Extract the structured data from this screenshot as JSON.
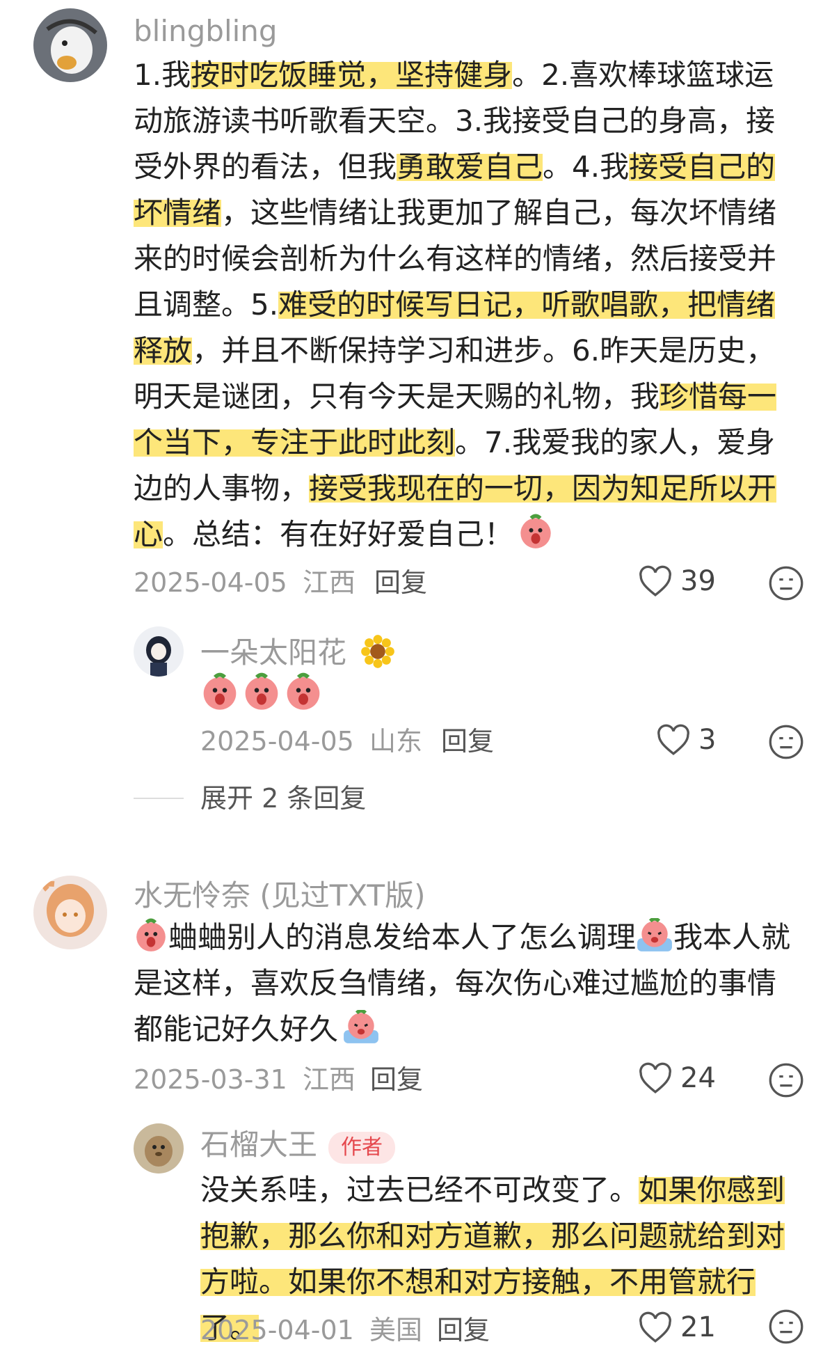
{
  "comments": [
    {
      "user": "blingbling",
      "segments": [
        {
          "t": "1.我",
          "h": false
        },
        {
          "t": "按时吃饭睡觉，坚持健身",
          "h": true
        },
        {
          "t": "。2.喜欢棒球篮球运动旅游读书听歌看天空。3.我接受自己的身高，接受外界的看法，但我",
          "h": false
        },
        {
          "t": "勇敢爱自己",
          "h": true
        },
        {
          "t": "。4.我",
          "h": false
        },
        {
          "t": "接受自己的坏情绪",
          "h": true
        },
        {
          "t": "，这些情绪让我更加了解自己，每次坏情绪来的时候会剖析为什么有这样的情绪，然后接受并且调整。5.",
          "h": false
        },
        {
          "t": "难受的时候写日记，听歌唱歌，把情绪释放",
          "h": true
        },
        {
          "t": "，并且不断保持学习和进步。6.昨天是历史，明天是谜团，只有今天是天赐的礼物，我",
          "h": false
        },
        {
          "t": "珍惜每一个当下，专注于此时此刻",
          "h": true
        },
        {
          "t": "。7.我爱我的家人，爱身边的人事物，",
          "h": false
        },
        {
          "t": "接受我现在的一切，因为知足所以开心",
          "h": true
        },
        {
          "t": "。总结：有在好好爱自己！",
          "h": false
        }
      ],
      "date": "2025-04-05",
      "location": "江西",
      "reply_label": "回复",
      "likes": "39",
      "replies": [
        {
          "user": "一朵太阳花",
          "date": "2025-04-05",
          "location": "山东",
          "reply_label": "回复",
          "likes": "3"
        }
      ],
      "expand_label": "展开 2 条回复"
    },
    {
      "user": "水无怜奈 (见过TXT版)",
      "text_parts": [
        "蛐蛐别人的消息发给本人了怎么调理",
        "我本人就是这样，喜欢反刍情绪，每次伤心难过尴尬的事情都能记好久好久"
      ],
      "date": "2025-03-31",
      "location": "江西",
      "reply_label": "回复",
      "likes": "24",
      "replies": [
        {
          "user": "石榴大王",
          "badge": "作者",
          "segments": [
            {
              "t": "没关系哇，过去已经不可改变了。",
              "h": false
            },
            {
              "t": "如果你感到抱歉，那么你和对方道歉，那么问题就给到对方啦。如果你不想和对方接触，不用管就行了。",
              "h": true
            }
          ],
          "date": "2025-04-01",
          "location": "美国",
          "reply_label": "回复",
          "likes": "21"
        }
      ]
    }
  ],
  "colors": {
    "highlight": "#fde67a",
    "muted": "#9a9a9a",
    "badge_bg": "#fde5e5",
    "badge_fg": "#e5484d"
  },
  "icons": [
    "heart-icon",
    "dislike-face-icon",
    "peach-emoji",
    "crying-emoji",
    "sunflower-emoji"
  ]
}
